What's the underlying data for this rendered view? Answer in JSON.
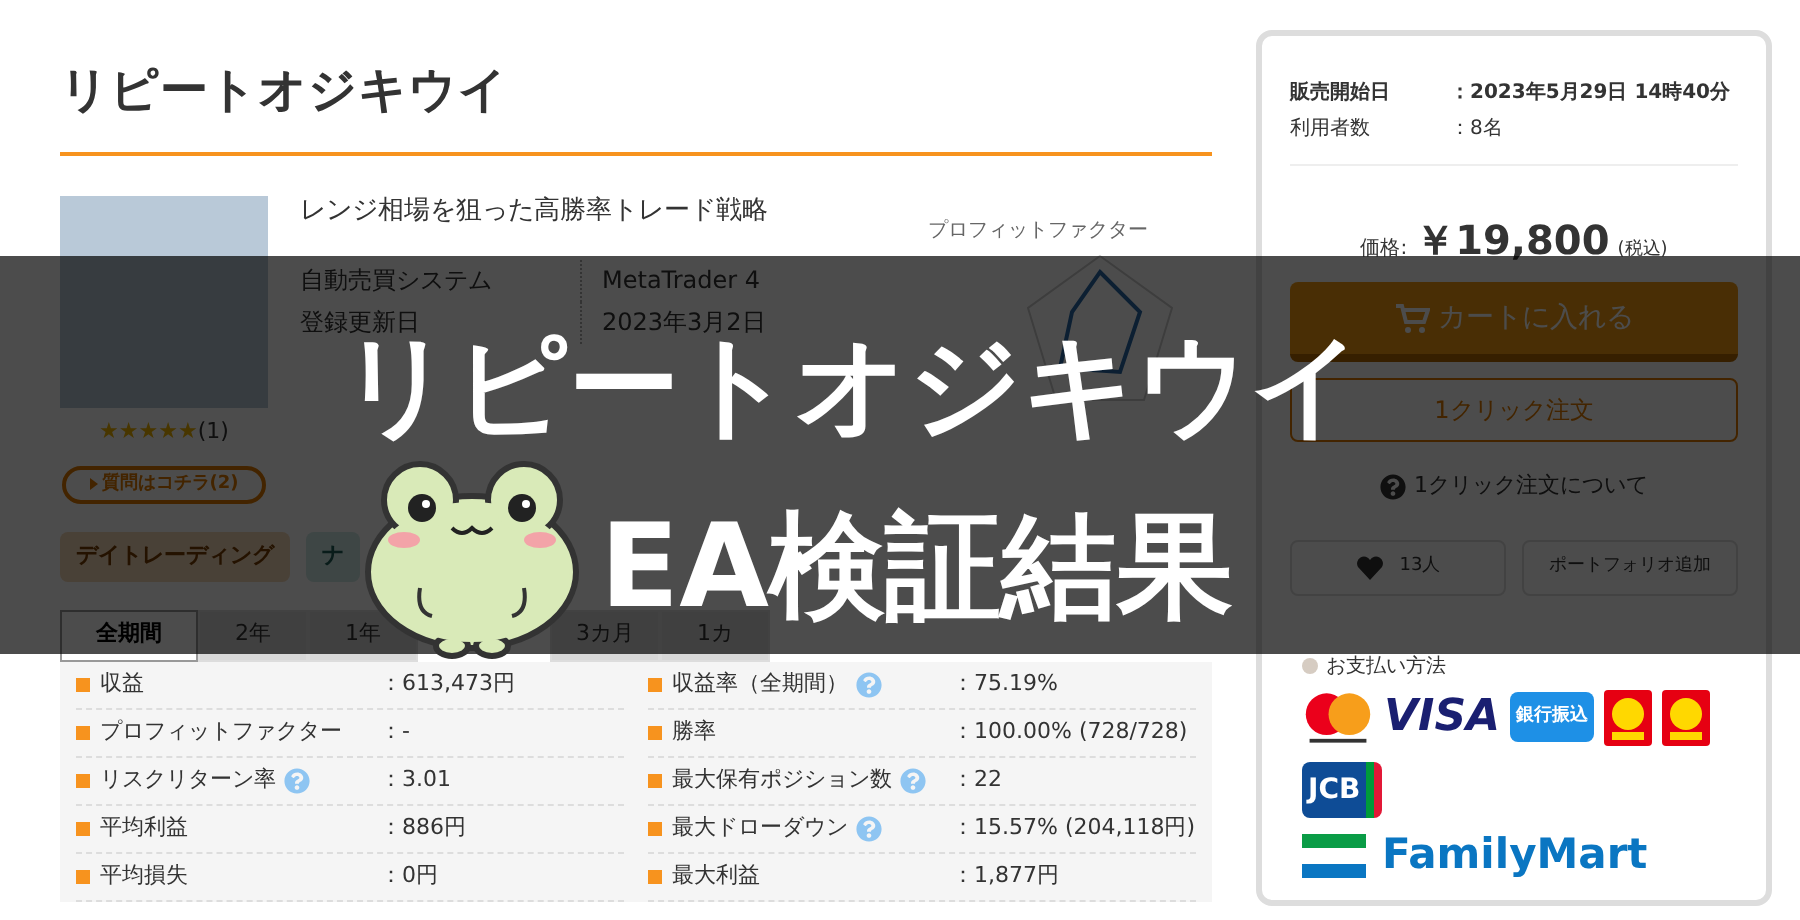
{
  "title": "リピートオジキウイ",
  "product": {
    "description": "レンジ相場を狙った高勝率トレード戦略",
    "stars": 5,
    "review_count": "(1)",
    "question_button": "質問はコチラ(2)",
    "info": [
      {
        "label": "自動売買システム",
        "value": "MetaTrader 4"
      },
      {
        "label": "登録更新日",
        "value": "2023年3月2日"
      }
    ],
    "radar_label": "プロフィットファクター"
  },
  "tags": [
    "デイトレーディング",
    "ナ"
  ],
  "period_tabs": [
    {
      "label": "全期間",
      "selected": true
    },
    {
      "label": "2年",
      "selected": false
    },
    {
      "label": "1年",
      "selected": false
    },
    {
      "label": "3カ月",
      "selected": false
    },
    {
      "label": "1カ",
      "selected": false
    }
  ],
  "stats": [
    {
      "label": "収益",
      "help": false,
      "value": "：613,473円"
    },
    {
      "label": "収益率（全期間）",
      "help": true,
      "value": "：75.19%"
    },
    {
      "label": "プロフィットファクター",
      "help": false,
      "value": "：-"
    },
    {
      "label": "勝率",
      "help": false,
      "value": "：100.00% (728/728)"
    },
    {
      "label": "リスクリターン率",
      "help": true,
      "value": "：3.01"
    },
    {
      "label": "最大保有ポジション数",
      "help": true,
      "value": "：22"
    },
    {
      "label": "平均利益",
      "help": false,
      "value": "：886円"
    },
    {
      "label": "最大ドローダウン",
      "help": true,
      "value": "：15.57% (204,118円)"
    },
    {
      "label": "平均損失",
      "help": false,
      "value": "：0円"
    },
    {
      "label": "最大利益",
      "help": false,
      "value": "：1,877円"
    }
  ],
  "sidebar": {
    "meta": [
      {
        "label": "販売開始日",
        "value": "：2023年5月29日 14時40分",
        "bold": true
      },
      {
        "label": "利用者数",
        "value": "：8名",
        "bold": false
      }
    ],
    "price_label": "価格:",
    "price": "￥19,800",
    "tax_note": "(税込)",
    "cart_button": "カートに入れる",
    "one_click_button": "1クリック注文",
    "one_click_help": "1クリック注文について",
    "favorite_count": "13人",
    "portfolio_button": "ポートフォリオ追加",
    "payment_title": "お支払い方法",
    "payment_logos": [
      {
        "kind": "mastercard"
      },
      {
        "kind": "visa",
        "text": "VISA"
      },
      {
        "kind": "bank",
        "text": "銀行振込"
      },
      {
        "kind": "d"
      },
      {
        "kind": "d"
      },
      {
        "kind": "jcb",
        "text": "JCB"
      },
      {
        "kind": "family",
        "text": "FamilyMart"
      }
    ]
  },
  "banner": {
    "line_1": "リピートオジキウイ",
    "line_2": "EA検証結果"
  }
}
